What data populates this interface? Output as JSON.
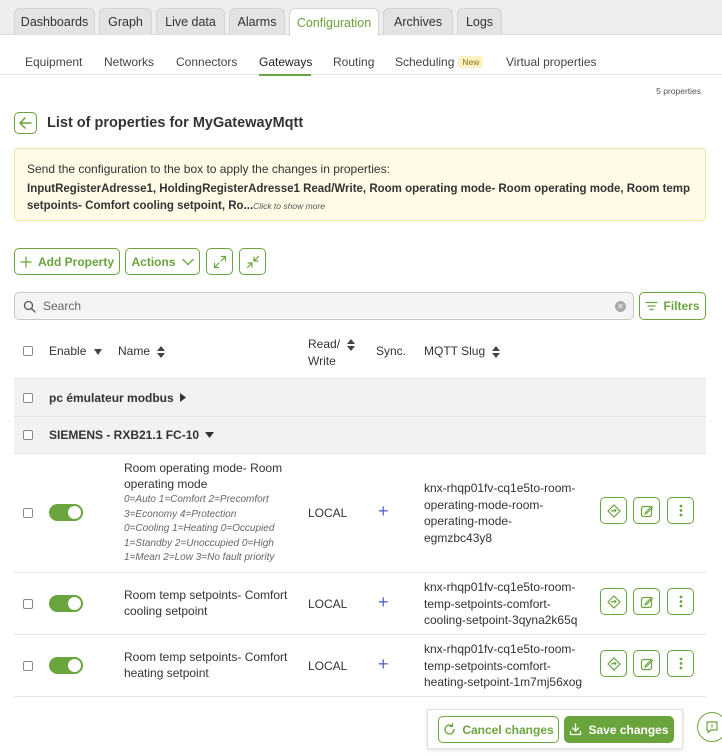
{
  "top_tabs": [
    "Dashboards",
    "Graph",
    "Live data",
    "Alarms",
    "Configuration",
    "Archives",
    "Logs"
  ],
  "active_top_tab": "Configuration",
  "sub_tabs": [
    "Equipment",
    "Networks",
    "Connectors",
    "Gateways",
    "Routing",
    "Scheduling",
    "Virtual properties"
  ],
  "active_sub_tab": "Gateways",
  "new_badge": "New",
  "property_count": "5 properties",
  "page_title": "List of properties for MyGatewayMqtt",
  "notice": {
    "line1": "Send the configuration to the box to apply the changes in properties:",
    "line2": "InputRegisterAdresse1, HoldingRegisterAdresse1 Read/Write, Room operating mode- Room operating mode, Room temp setpoints- Comfort cooling setpoint, Ro...",
    "more": "Click to show more"
  },
  "toolbar": {
    "add_property": "Add Property",
    "actions": "Actions"
  },
  "search": {
    "placeholder": "Search"
  },
  "filters_label": "Filters",
  "columns": {
    "enable": "Enable",
    "name": "Name",
    "read_write_1": "Read/",
    "read_write_2": "Write",
    "sync": "Sync.",
    "mqtt_slug": "MQTT Slug"
  },
  "groups": [
    "pc émulateur modbus",
    "SIEMENS - RXB21.1 FC-10"
  ],
  "rows": [
    {
      "name": [
        "Room operating mode- Room",
        "operating mode"
      ],
      "desc": [
        "0=Auto 1=Comfort 2=Precomfort",
        "3=Economy 4=Protection",
        "0=Cooling 1=Heating 0=Occupied",
        "1=Standby 2=Unoccupied 0=High",
        "1=Mean 2=Low 3=No fault priority"
      ],
      "access": "LOCAL",
      "slug": [
        "knx-rhqp01fv-cq1e5to-room-",
        "operating-mode-room-",
        "operating-mode-",
        "egmzbc43y8"
      ],
      "enabled": true
    },
    {
      "name": [
        "Room temp setpoints- Comfort",
        "cooling setpoint"
      ],
      "desc": [],
      "access": "LOCAL",
      "slug": [
        "knx-rhqp01fv-cq1e5to-room-",
        "temp-setpoints-comfort-",
        "cooling-setpoint-3qyna2k65q"
      ],
      "enabled": true
    },
    {
      "name": [
        "Room temp setpoints- Comfort",
        "heating setpoint"
      ],
      "desc": [],
      "access": "LOCAL",
      "slug": [
        "knx-rhqp01fv-cq1e5to-room-",
        "temp-setpoints-comfort-",
        "heating-setpoint-1m7mj56xog"
      ],
      "enabled": true
    }
  ],
  "footer": {
    "cancel": "Cancel changes",
    "save": "Save changes"
  },
  "colors": {
    "accent": "#6aa43c",
    "sync": "#5566cc",
    "notice_bg": "#fffbe6"
  }
}
